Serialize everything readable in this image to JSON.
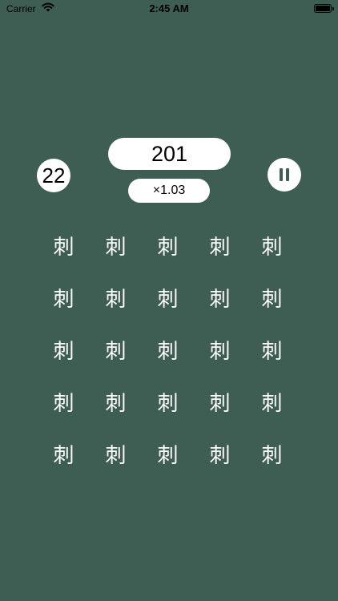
{
  "status_bar": {
    "carrier": "Carrier",
    "time": "2:45 AM"
  },
  "hud": {
    "count": "22",
    "score": "201",
    "multiplier": "×1.03"
  },
  "grid": {
    "rows": 5,
    "columns": 5,
    "cells": [
      "刺",
      "刺",
      "刺",
      "刺",
      "刺",
      "刺",
      "刺",
      "刺",
      "刺",
      "刺",
      "刺",
      "刺",
      "刺",
      "刺",
      "刺",
      "刺",
      "刺",
      "刺",
      "刺",
      "刺",
      "刺",
      "刺",
      "刺",
      "刺",
      "刺"
    ]
  },
  "colors": {
    "background": "#3e5d53",
    "pill": "#ffffff",
    "glyph": "#ffffff"
  },
  "icons": {
    "pause": "pause-icon",
    "wifi": "wifi-icon",
    "battery": "battery-icon"
  }
}
